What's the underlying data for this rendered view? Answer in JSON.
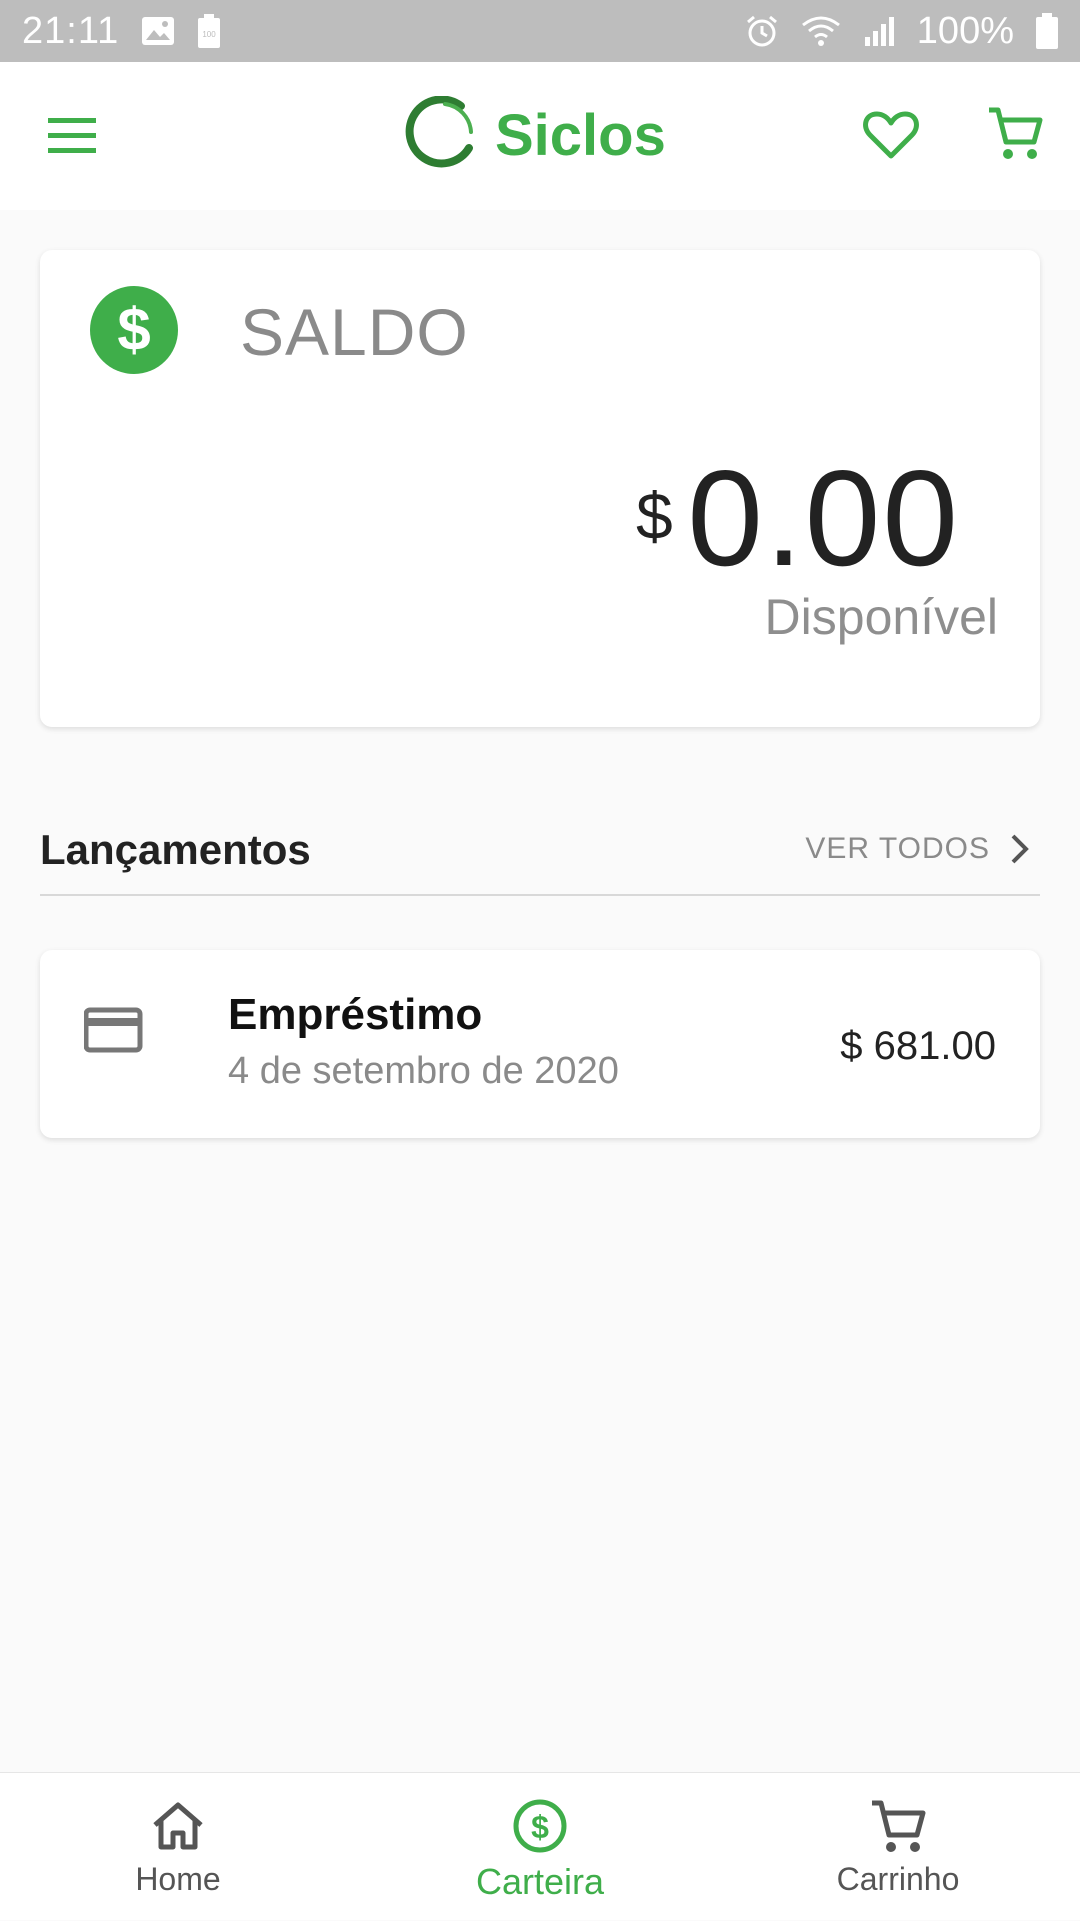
{
  "status_bar": {
    "time": "21:11",
    "battery": "100%",
    "icons": [
      "image-icon",
      "battery-saver-icon",
      "alarm-icon",
      "wifi-icon",
      "signal-icon",
      "battery-icon"
    ]
  },
  "app_bar": {
    "brand": "Siclos",
    "accent_color": "#3fae4a",
    "icons": [
      "menu-icon",
      "heart-icon",
      "cart-icon"
    ]
  },
  "balance": {
    "title": "SALDO",
    "currency": "$",
    "amount": "0.00",
    "subtitle": "Disponível",
    "icon": "dollar-circle-icon"
  },
  "transactions": {
    "section_title": "Lançamentos",
    "see_all": "VER TODOS",
    "items": [
      {
        "title": "Empréstimo",
        "date": "4 de setembro de 2020",
        "amount": "$ 681.00",
        "icon": "credit-card-icon"
      }
    ]
  },
  "bottom_nav": {
    "items": [
      {
        "label": "Home",
        "icon": "home-icon",
        "active": false
      },
      {
        "label": "Carteira",
        "icon": "dollar-circle-icon",
        "active": true
      },
      {
        "label": "Carrinho",
        "icon": "cart-icon",
        "active": false
      }
    ]
  }
}
